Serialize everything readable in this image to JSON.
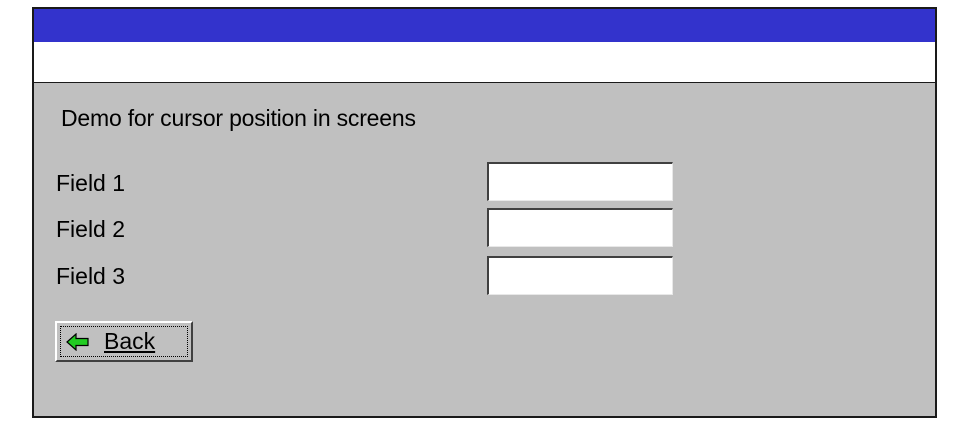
{
  "window": {
    "title": ""
  },
  "screen": {
    "heading": "Demo for cursor position in screens",
    "fields": [
      {
        "label": "Field 1",
        "value": ""
      },
      {
        "label": "Field 2",
        "value": ""
      },
      {
        "label": "Field 3",
        "value": ""
      }
    ],
    "back_button": {
      "label": "Back",
      "icon": "arrow-left-icon",
      "icon_color": "#22cc22"
    }
  },
  "colors": {
    "titlebar": "#3333cc",
    "background": "#c0c0c0"
  }
}
